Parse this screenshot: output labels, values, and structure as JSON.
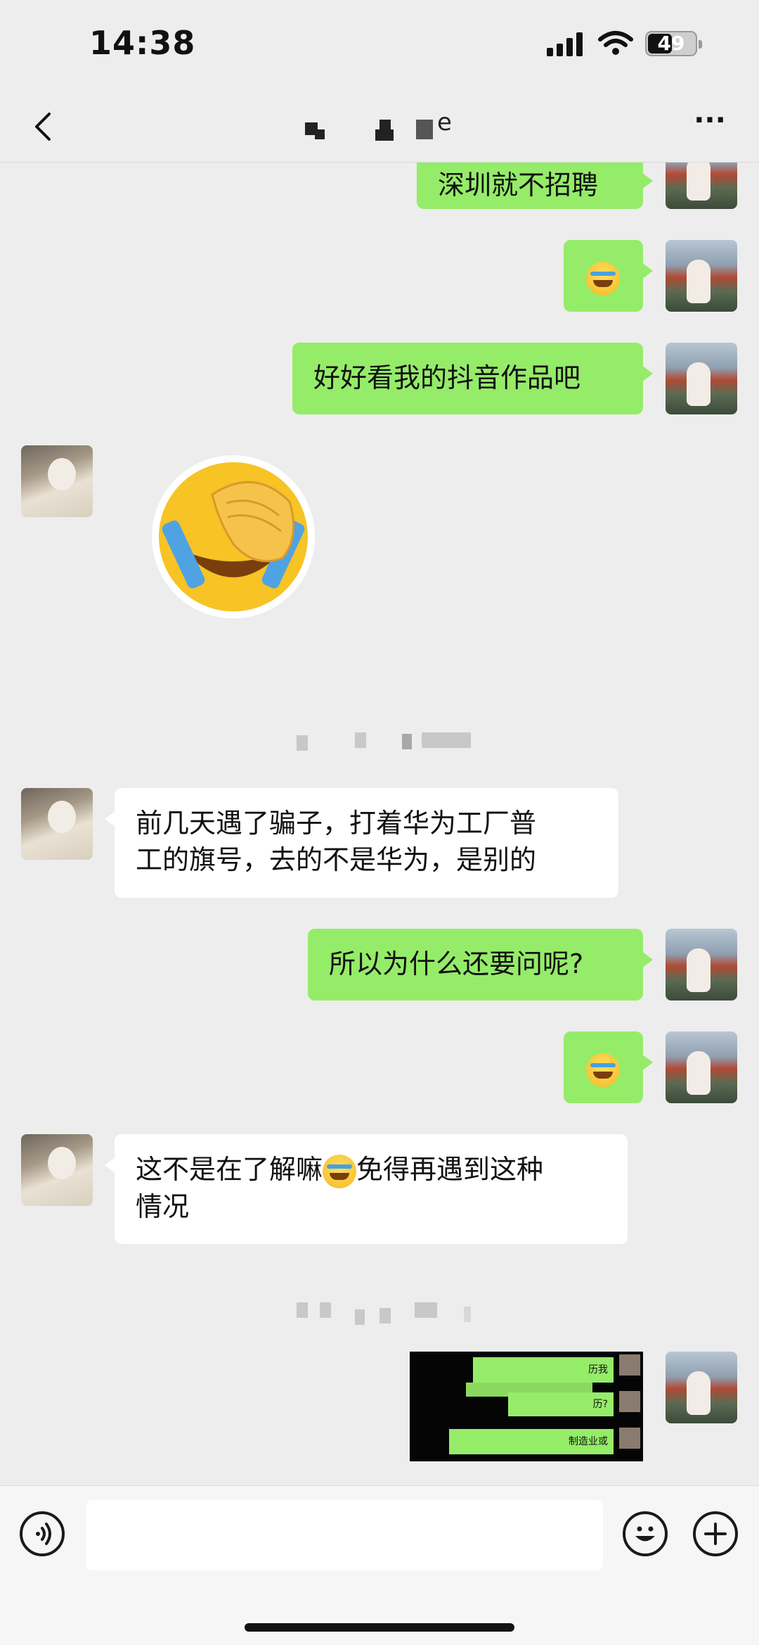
{
  "status_bar": {
    "time": "14:38",
    "battery": "49"
  },
  "nav": {
    "title_visible_suffix": "e",
    "more_label": "···"
  },
  "messages": [
    {
      "side": "me",
      "type": "text",
      "text": "深圳就不招聘"
    },
    {
      "side": "me",
      "type": "emoji",
      "emoji": "crying-laughing-emoji"
    },
    {
      "side": "me",
      "type": "text",
      "text": "好好看我的抖音作品吧"
    },
    {
      "side": "them",
      "type": "sticker",
      "emoji": "facepalm-laughing-emoji"
    },
    {
      "side": "them",
      "type": "text",
      "lines": [
        "前几天遇了骗子，打着华为工厂普",
        "工的旗号，去的不是华为，是别的"
      ]
    },
    {
      "side": "me",
      "type": "text",
      "text": "所以为什么还要问呢?"
    },
    {
      "side": "me",
      "type": "emoji",
      "emoji": "crying-laughing-emoji"
    },
    {
      "side": "them",
      "type": "text",
      "text_before": "这不是在了解嘛",
      "text_after": "免得再遇到这种",
      "line2": "情况"
    },
    {
      "side": "me",
      "type": "image",
      "snippets": [
        "历我",
        "历?",
        "制造业或"
      ]
    }
  ],
  "colors": {
    "my_bubble": "#95ec69",
    "their_bubble": "#ffffff",
    "background": "#ededed"
  },
  "icons": [
    "back-chevron-icon",
    "more-options-icon",
    "voice-input-icon",
    "emoji-icon",
    "plus-icon"
  ]
}
